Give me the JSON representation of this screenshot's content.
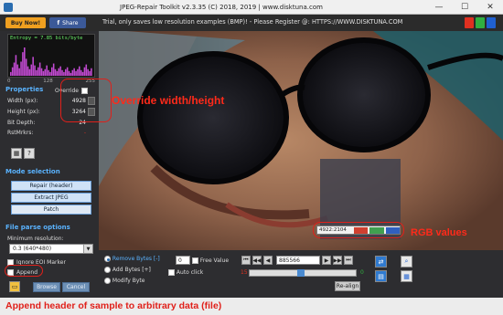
{
  "window": {
    "title": "JPEG-Repair Toolkit v2.3.35 (C) 2018, 2019 | www.disktuna.com",
    "minimize": "—",
    "maximize": "☐",
    "close": "✕"
  },
  "topbar": {
    "buy_label": "Buy Now!",
    "share_label": "Share",
    "trial_text": "Trial, only saves low resolution examples (BMP)! - Please Register @: HTTPS://WWW.DISKTUNA.COM",
    "colors": [
      "#e03020",
      "#30b040",
      "#2060d0"
    ]
  },
  "entropy": {
    "label": "Entropy = 7.85 bits/byte",
    "axis": [
      "0",
      "128",
      "255"
    ],
    "histogram": [
      4,
      9,
      14,
      22,
      12,
      8,
      15,
      25,
      30,
      18,
      10,
      7,
      12,
      20,
      11,
      6,
      9,
      14,
      8,
      5,
      7,
      11,
      6,
      4,
      9,
      13,
      7,
      5,
      8,
      10,
      6,
      4,
      7,
      9,
      5,
      3,
      6,
      8,
      5,
      7,
      10,
      6,
      4,
      9,
      12,
      7,
      5,
      8
    ]
  },
  "properties": {
    "heading": "Properties",
    "override_label": "Override",
    "width_label": "Width (px):",
    "width_value": "4928",
    "height_label": "Height (px):",
    "height_value": "3264",
    "bitdepth_label": "Bit Depth:",
    "bitdepth_value": "24",
    "rstmrkrs_label": "RstMrkrs:",
    "rstmrkrs_value": "-"
  },
  "mode": {
    "heading": "Mode selection",
    "repair_label": "Repair (header)",
    "extract_label": "Extract JPEG",
    "patch_label": "Patch"
  },
  "fileparse": {
    "heading": "File parse options",
    "minres_label": "Minimum resolution:",
    "minres_value": "0.3 (640*480)",
    "ignore_eoi_label": "Ignore EOI Marker",
    "append_label": "Append",
    "browse_label": "Browse",
    "cancel_label": "Cancel"
  },
  "image": {
    "rgb_readout": "4922:2104"
  },
  "controls": {
    "remove_bytes": "Remove Bytes [-]",
    "add_bytes": "Add Bytes [+]",
    "modify_byte": "Modify Byte",
    "bytes_value": "0",
    "free_value_label": "Free Value",
    "auto_click_label": "Auto click",
    "offset_value": "885566",
    "realign_label": "Re-align",
    "counter_left": "15",
    "counter_right": "0"
  },
  "annotations": {
    "override": "Override width/height",
    "rgb": "RGB values",
    "append": "Append header of sample to arbitrary data (file)"
  }
}
